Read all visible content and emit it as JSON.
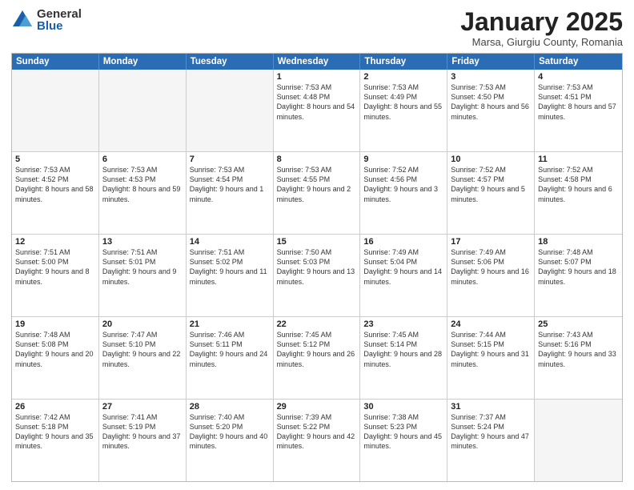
{
  "logo": {
    "general": "General",
    "blue": "Blue"
  },
  "header": {
    "title": "January 2025",
    "subtitle": "Marsa, Giurgiu County, Romania"
  },
  "dayHeaders": [
    "Sunday",
    "Monday",
    "Tuesday",
    "Wednesday",
    "Thursday",
    "Friday",
    "Saturday"
  ],
  "weeks": [
    [
      {
        "day": "",
        "info": ""
      },
      {
        "day": "",
        "info": ""
      },
      {
        "day": "",
        "info": ""
      },
      {
        "day": "1",
        "info": "Sunrise: 7:53 AM\nSunset: 4:48 PM\nDaylight: 8 hours\nand 54 minutes."
      },
      {
        "day": "2",
        "info": "Sunrise: 7:53 AM\nSunset: 4:49 PM\nDaylight: 8 hours\nand 55 minutes."
      },
      {
        "day": "3",
        "info": "Sunrise: 7:53 AM\nSunset: 4:50 PM\nDaylight: 8 hours\nand 56 minutes."
      },
      {
        "day": "4",
        "info": "Sunrise: 7:53 AM\nSunset: 4:51 PM\nDaylight: 8 hours\nand 57 minutes."
      }
    ],
    [
      {
        "day": "5",
        "info": "Sunrise: 7:53 AM\nSunset: 4:52 PM\nDaylight: 8 hours\nand 58 minutes."
      },
      {
        "day": "6",
        "info": "Sunrise: 7:53 AM\nSunset: 4:53 PM\nDaylight: 8 hours\nand 59 minutes."
      },
      {
        "day": "7",
        "info": "Sunrise: 7:53 AM\nSunset: 4:54 PM\nDaylight: 9 hours\nand 1 minute."
      },
      {
        "day": "8",
        "info": "Sunrise: 7:53 AM\nSunset: 4:55 PM\nDaylight: 9 hours\nand 2 minutes."
      },
      {
        "day": "9",
        "info": "Sunrise: 7:52 AM\nSunset: 4:56 PM\nDaylight: 9 hours\nand 3 minutes."
      },
      {
        "day": "10",
        "info": "Sunrise: 7:52 AM\nSunset: 4:57 PM\nDaylight: 9 hours\nand 5 minutes."
      },
      {
        "day": "11",
        "info": "Sunrise: 7:52 AM\nSunset: 4:58 PM\nDaylight: 9 hours\nand 6 minutes."
      }
    ],
    [
      {
        "day": "12",
        "info": "Sunrise: 7:51 AM\nSunset: 5:00 PM\nDaylight: 9 hours\nand 8 minutes."
      },
      {
        "day": "13",
        "info": "Sunrise: 7:51 AM\nSunset: 5:01 PM\nDaylight: 9 hours\nand 9 minutes."
      },
      {
        "day": "14",
        "info": "Sunrise: 7:51 AM\nSunset: 5:02 PM\nDaylight: 9 hours\nand 11 minutes."
      },
      {
        "day": "15",
        "info": "Sunrise: 7:50 AM\nSunset: 5:03 PM\nDaylight: 9 hours\nand 13 minutes."
      },
      {
        "day": "16",
        "info": "Sunrise: 7:49 AM\nSunset: 5:04 PM\nDaylight: 9 hours\nand 14 minutes."
      },
      {
        "day": "17",
        "info": "Sunrise: 7:49 AM\nSunset: 5:06 PM\nDaylight: 9 hours\nand 16 minutes."
      },
      {
        "day": "18",
        "info": "Sunrise: 7:48 AM\nSunset: 5:07 PM\nDaylight: 9 hours\nand 18 minutes."
      }
    ],
    [
      {
        "day": "19",
        "info": "Sunrise: 7:48 AM\nSunset: 5:08 PM\nDaylight: 9 hours\nand 20 minutes."
      },
      {
        "day": "20",
        "info": "Sunrise: 7:47 AM\nSunset: 5:10 PM\nDaylight: 9 hours\nand 22 minutes."
      },
      {
        "day": "21",
        "info": "Sunrise: 7:46 AM\nSunset: 5:11 PM\nDaylight: 9 hours\nand 24 minutes."
      },
      {
        "day": "22",
        "info": "Sunrise: 7:45 AM\nSunset: 5:12 PM\nDaylight: 9 hours\nand 26 minutes."
      },
      {
        "day": "23",
        "info": "Sunrise: 7:45 AM\nSunset: 5:14 PM\nDaylight: 9 hours\nand 28 minutes."
      },
      {
        "day": "24",
        "info": "Sunrise: 7:44 AM\nSunset: 5:15 PM\nDaylight: 9 hours\nand 31 minutes."
      },
      {
        "day": "25",
        "info": "Sunrise: 7:43 AM\nSunset: 5:16 PM\nDaylight: 9 hours\nand 33 minutes."
      }
    ],
    [
      {
        "day": "26",
        "info": "Sunrise: 7:42 AM\nSunset: 5:18 PM\nDaylight: 9 hours\nand 35 minutes."
      },
      {
        "day": "27",
        "info": "Sunrise: 7:41 AM\nSunset: 5:19 PM\nDaylight: 9 hours\nand 37 minutes."
      },
      {
        "day": "28",
        "info": "Sunrise: 7:40 AM\nSunset: 5:20 PM\nDaylight: 9 hours\nand 40 minutes."
      },
      {
        "day": "29",
        "info": "Sunrise: 7:39 AM\nSunset: 5:22 PM\nDaylight: 9 hours\nand 42 minutes."
      },
      {
        "day": "30",
        "info": "Sunrise: 7:38 AM\nSunset: 5:23 PM\nDaylight: 9 hours\nand 45 minutes."
      },
      {
        "day": "31",
        "info": "Sunrise: 7:37 AM\nSunset: 5:24 PM\nDaylight: 9 hours\nand 47 minutes."
      },
      {
        "day": "",
        "info": ""
      }
    ]
  ]
}
